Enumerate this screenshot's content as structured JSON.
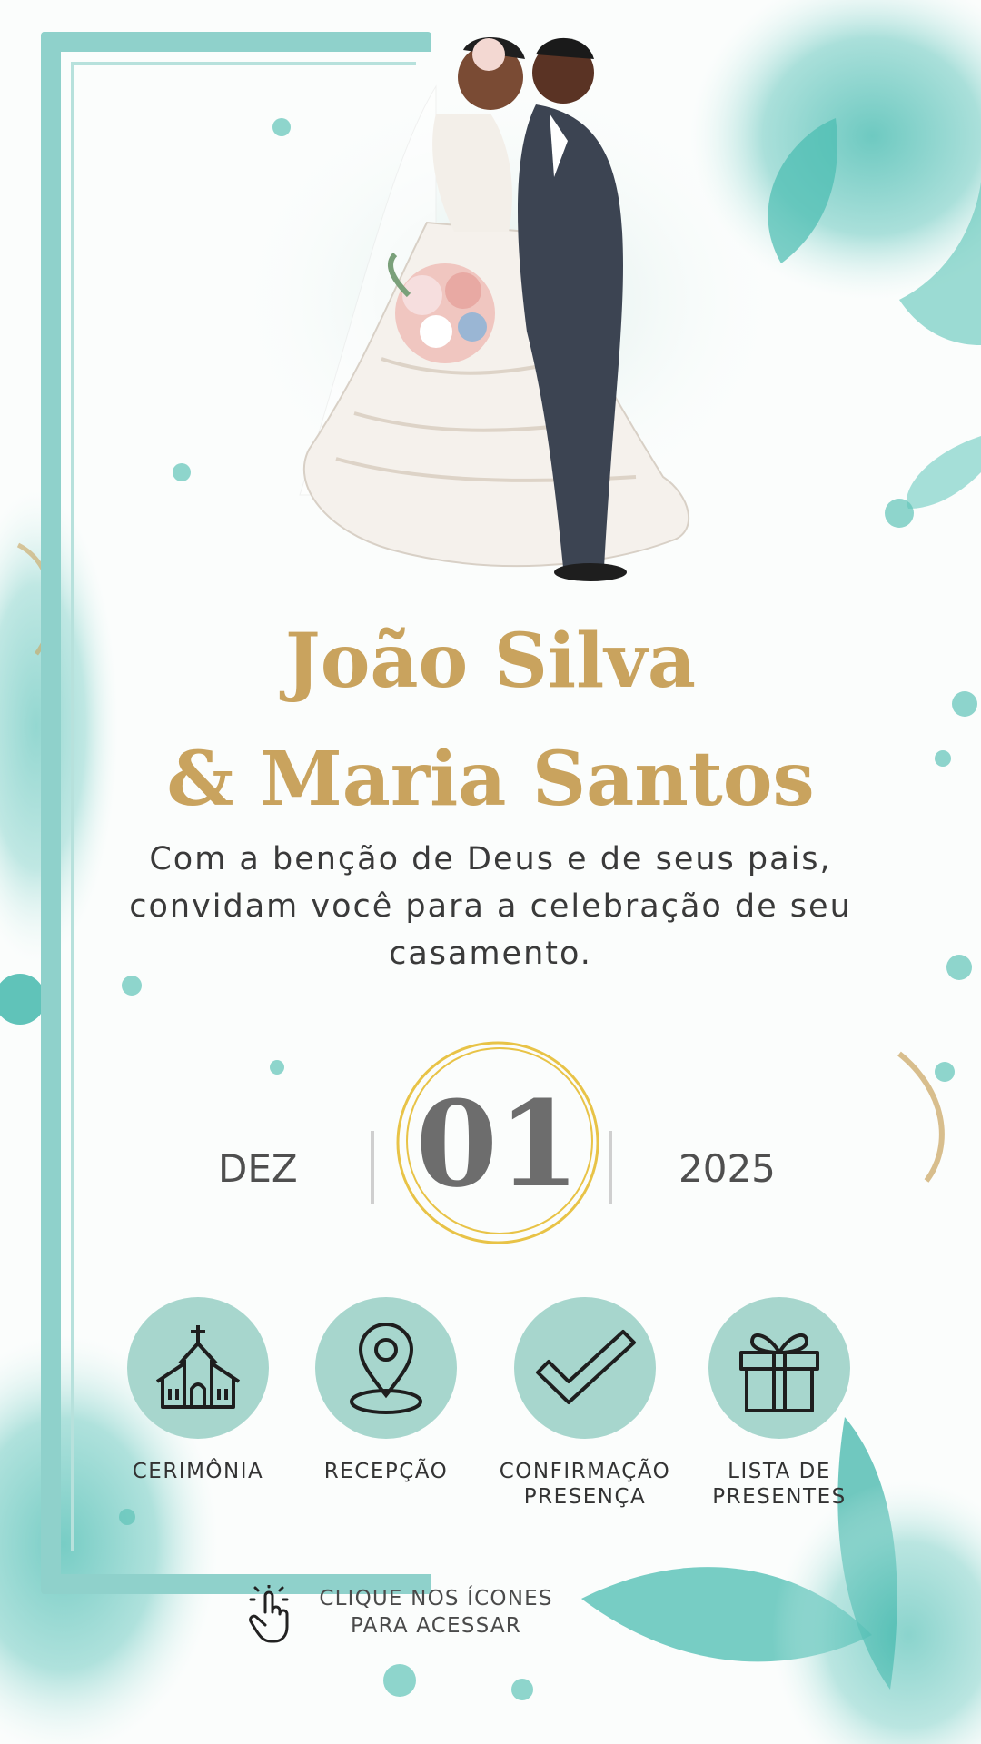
{
  "couple": {
    "name1": "João Silva",
    "name2": "& Maria Santos"
  },
  "blessing": "Com a benção de Deus e de seus pais, convidam você para a celebração de seu casamento.",
  "date": {
    "month": "DEZ",
    "day": "01",
    "year": "2025"
  },
  "icons": [
    {
      "label": "CERIMÔNIA",
      "icon": "church-icon"
    },
    {
      "label": "RECEPÇÃO",
      "icon": "location-pin-icon"
    },
    {
      "label_line1": "CONFIRMAÇÃO",
      "label_line2": "PRESENÇA",
      "icon": "checkmark-icon"
    },
    {
      "label_line1": "LISTA DE",
      "label_line2": "PRESENTES",
      "icon": "gift-icon"
    }
  ],
  "hint": {
    "line1": "CLIQUE NOS ÍCONES",
    "line2": "PARA ACESSAR",
    "icon": "tap-hand-icon"
  },
  "colors": {
    "gold": "#c9a35e",
    "teal": "#a7d6cd",
    "ring": "#e8c347"
  }
}
